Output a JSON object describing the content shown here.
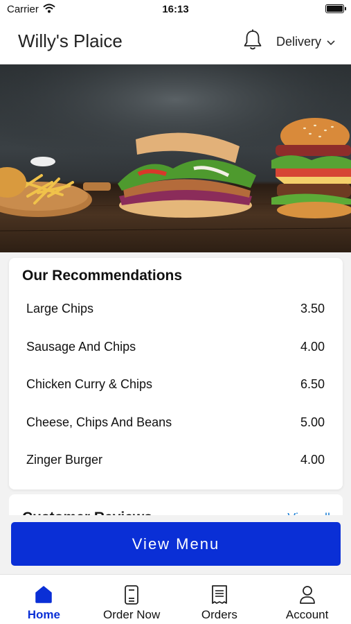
{
  "status_bar": {
    "carrier": "Carrier",
    "time": "16:13"
  },
  "header": {
    "title": "Willy's Plaice",
    "delivery_label": "Delivery"
  },
  "recommendations": {
    "title": "Our Recommendations",
    "items": [
      {
        "name": "Large Chips",
        "price": "3.50"
      },
      {
        "name": "Sausage And Chips",
        "price": "4.00"
      },
      {
        "name": "Chicken Curry & Chips",
        "price": "6.50"
      },
      {
        "name": "Cheese, Chips And Beans",
        "price": "5.00"
      },
      {
        "name": "Zinger Burger",
        "price": "4.00"
      }
    ]
  },
  "reviews": {
    "title": "Customer Reviews",
    "view_all": "View all"
  },
  "cta": {
    "label": "View Menu"
  },
  "tabbar": {
    "items": [
      {
        "label": "Home",
        "icon": "home-icon",
        "active": true
      },
      {
        "label": "Order Now",
        "icon": "order-now-icon",
        "active": false
      },
      {
        "label": "Orders",
        "icon": "orders-receipt-icon",
        "active": false
      },
      {
        "label": "Account",
        "icon": "account-user-icon",
        "active": false
      }
    ]
  },
  "colors": {
    "accent": "#0a2fd6",
    "link": "#1a7fd6",
    "background": "#f2f2f2"
  }
}
